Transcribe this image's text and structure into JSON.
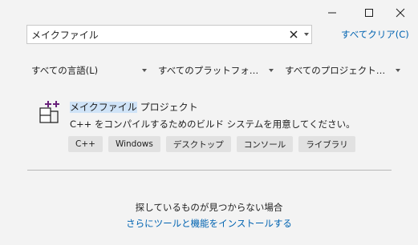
{
  "window": {
    "controls": [
      "minimize-icon",
      "maximize-icon",
      "close-icon"
    ]
  },
  "search": {
    "value": "メイクファイル",
    "clear_icon": "close-icon",
    "dropdown_icon": "chevron-down-icon"
  },
  "clear_all": "すべてクリア(C)",
  "filters": [
    {
      "label": "すべての言語(L)"
    },
    {
      "label": "すべてのプラットフォーム(P)"
    },
    {
      "label": "すべてのプロジェクトの..."
    }
  ],
  "result": {
    "icon": "makefile-project-icon",
    "title_highlight": "メイクファイル",
    "title_rest": " プロジェクト",
    "description": "C++ をコンパイルするためのビルド システムを用意してください。",
    "tags": [
      "C++",
      "Windows",
      "デスクトップ",
      "コンソール",
      "ライブラリ"
    ]
  },
  "not_found": {
    "text": "探しているものが見つからない場合",
    "link": "さらにツールと機能をインストールする"
  },
  "colors": {
    "background": "#f3f3f3",
    "link": "#0063b1",
    "highlight": "#cfe3f7",
    "tag_bg": "#e1e1e1",
    "icon_accent": "#68217a"
  }
}
